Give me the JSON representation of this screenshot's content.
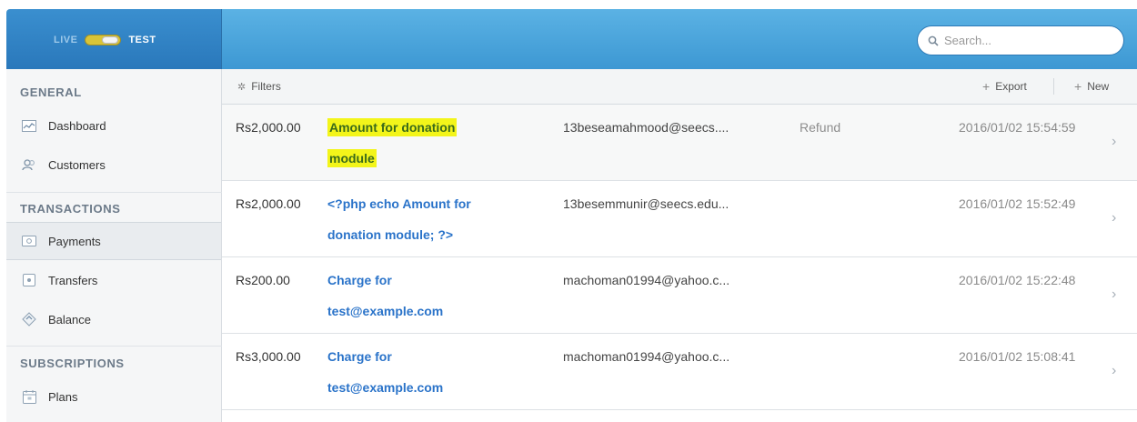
{
  "topbar": {
    "mode_live": "LIVE",
    "mode_test": "TEST",
    "search_placeholder": "Search..."
  },
  "sidebar": {
    "sections": [
      {
        "heading": "GENERAL",
        "items": [
          {
            "label": "Dashboard",
            "icon": "chart-icon"
          },
          {
            "label": "Customers",
            "icon": "users-icon"
          }
        ]
      },
      {
        "heading": "TRANSACTIONS",
        "items": [
          {
            "label": "Payments",
            "icon": "payment-card-icon",
            "active": true
          },
          {
            "label": "Transfers",
            "icon": "transfer-icon"
          },
          {
            "label": "Balance",
            "icon": "balance-icon"
          }
        ]
      },
      {
        "heading": "SUBSCRIPTIONS",
        "items": [
          {
            "label": "Plans",
            "icon": "calendar-icon"
          }
        ]
      }
    ]
  },
  "toolbar": {
    "filters_label": "Filters",
    "export_label": "Export",
    "new_label": "New"
  },
  "payments": [
    {
      "amount": "Rs2,000.00",
      "description_line1": "Amount for donation",
      "description_line2": "module",
      "email": "13beseamahmood@seecs....",
      "status": "Refund",
      "date": "2016/01/02 15:54:59",
      "highlighted": true
    },
    {
      "amount": "Rs2,000.00",
      "description_line1": "<?php echo Amount for",
      "description_line2": "donation module; ?>",
      "email": "13besemmunir@seecs.edu...",
      "status": "",
      "date": "2016/01/02 15:52:49"
    },
    {
      "amount": "Rs200.00",
      "description_line1": "Charge for",
      "description_line2": "test@example.com",
      "email": "machoman01994@yahoo.c...",
      "status": "",
      "date": "2016/01/02 15:22:48"
    },
    {
      "amount": "Rs3,000.00",
      "description_line1": "Charge for",
      "description_line2": "test@example.com",
      "email": "machoman01994@yahoo.c...",
      "status": "",
      "date": "2016/01/02 15:08:41"
    }
  ],
  "colors": {
    "accent": "#3d98d3",
    "link": "#2a73c9",
    "highlight": "#f3f51a"
  }
}
